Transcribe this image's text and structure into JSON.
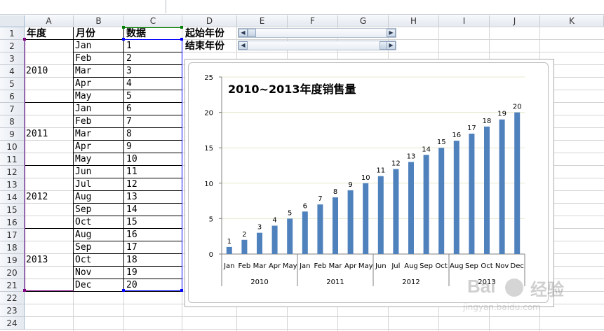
{
  "columns": [
    "A",
    "B",
    "C",
    "D",
    "E",
    "F",
    "G",
    "H",
    "I",
    "J",
    "K"
  ],
  "rows": [
    "1",
    "2",
    "3",
    "4",
    "5",
    "6",
    "7",
    "8",
    "9",
    "10",
    "11",
    "12",
    "13",
    "14",
    "15",
    "16",
    "17",
    "18",
    "19",
    "20",
    "21",
    "22",
    "23",
    "24"
  ],
  "headers": {
    "year": "年度",
    "month": "月份",
    "data": "数据"
  },
  "controls": {
    "start_label": "起始年份",
    "end_label": "结束年份",
    "start_value": 0.0,
    "end_value": 1.0
  },
  "years": [
    {
      "label": "2010",
      "months": [
        "Jan",
        "Feb",
        "Mar",
        "Apr",
        "May"
      ],
      "values": [
        "1",
        "2",
        "3",
        "4",
        "5"
      ]
    },
    {
      "label": "2011",
      "months": [
        "Jan",
        "Feb",
        "Mar",
        "Apr",
        "May"
      ],
      "values": [
        "6",
        "7",
        "8",
        "9",
        "10"
      ]
    },
    {
      "label": "2012",
      "months": [
        "Jun",
        "Jul",
        "Aug",
        "Sep",
        "Oct"
      ],
      "values": [
        "11",
        "12",
        "13",
        "14",
        "15"
      ]
    },
    {
      "label": "2013",
      "months": [
        "Aug",
        "Sep",
        "Oct",
        "Nov",
        "Dec"
      ],
      "values": [
        "16",
        "17",
        "18",
        "19",
        "20"
      ]
    }
  ],
  "colors": {
    "bar": "#4f81bd",
    "grid": "#e8e8cf",
    "selection_blue": "#0000ff",
    "selection_purple": "#800080",
    "selection_green": "#008000"
  },
  "chart_data": {
    "type": "bar",
    "title": "2010~2013年度销售量",
    "categories": [
      "Jan",
      "Feb",
      "Mar",
      "Apr",
      "May",
      "Jan",
      "Feb",
      "Mar",
      "Apr",
      "May",
      "Jun",
      "Jul",
      "Aug",
      "Sep",
      "Oct",
      "Aug",
      "Sep",
      "Oct",
      "Nov",
      "Dec"
    ],
    "groups": [
      {
        "label": "2010",
        "count": 5
      },
      {
        "label": "2011",
        "count": 5
      },
      {
        "label": "2012",
        "count": 5
      },
      {
        "label": "2013",
        "count": 5
      }
    ],
    "values": [
      1,
      2,
      3,
      4,
      5,
      6,
      7,
      8,
      9,
      10,
      11,
      12,
      13,
      14,
      15,
      16,
      17,
      18,
      19,
      20
    ],
    "ylim": [
      0,
      25
    ],
    "yticks": [
      0,
      5,
      10,
      15,
      20,
      25
    ],
    "data_labels": true,
    "grid": true,
    "legend": "none"
  },
  "watermark": {
    "brand": "Bai",
    "name": "经验",
    "url": "jingyan.baidu.com"
  }
}
